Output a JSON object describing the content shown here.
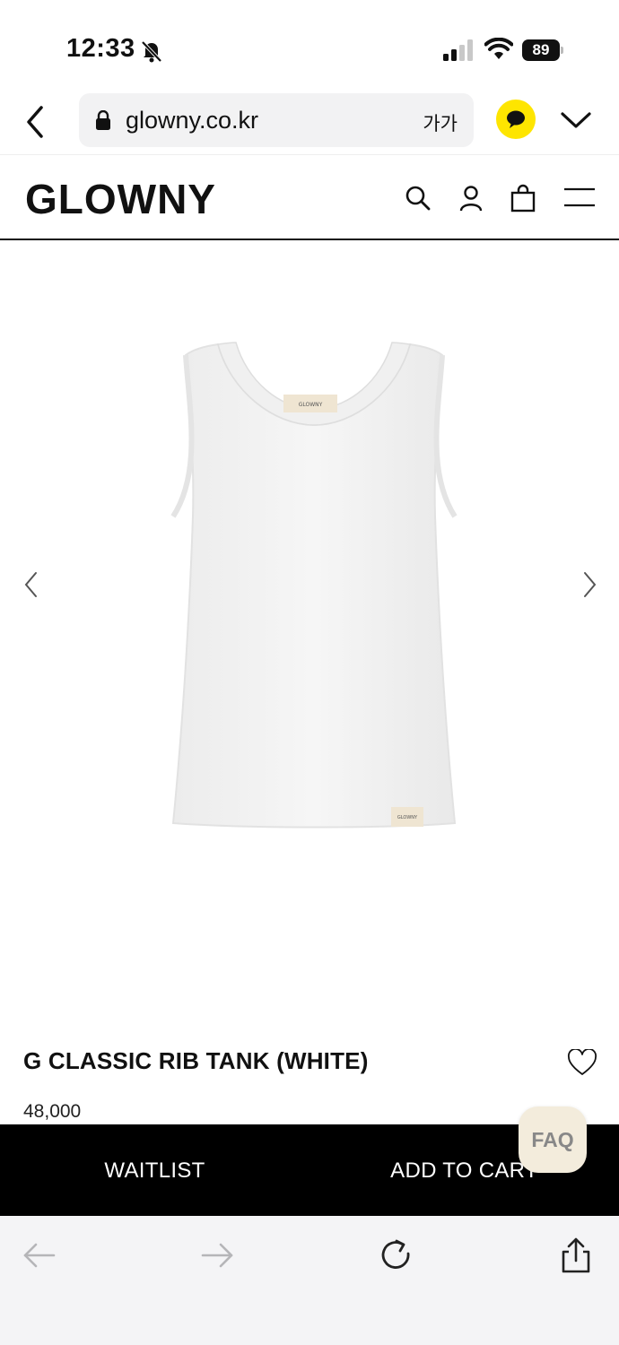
{
  "status_bar": {
    "time": "12:33",
    "battery": "89"
  },
  "browser": {
    "url": "glowny.co.kr",
    "text_size_button": "가가"
  },
  "site": {
    "logo": "GLOWNY"
  },
  "product": {
    "name": "G CLASSIC RIB TANK (WHITE)",
    "price": "48,000",
    "image_icon": "white-tank-top",
    "label_text": "GLOWNY"
  },
  "cta": {
    "waitlist_label": "WAITLIST",
    "add_to_cart_label": "ADD TO CART",
    "faq_label": "FAQ"
  },
  "colors": {
    "kakao_yellow": "#fee500",
    "cta_background": "#000000",
    "faq_background": "#f3ecdc"
  }
}
